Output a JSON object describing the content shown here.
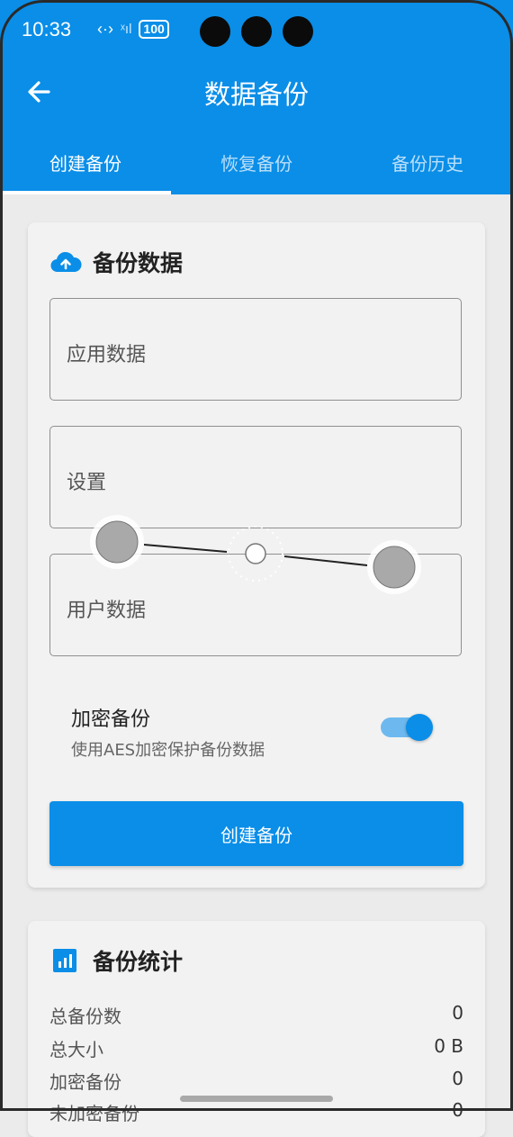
{
  "status_bar": {
    "time": "10:33",
    "network_icon": "‹·›",
    "signal_icon": "ˣıl",
    "battery": "100"
  },
  "header": {
    "title": "数据备份",
    "back_icon": "arrow-left-icon",
    "background_color": "#0a8ee8"
  },
  "tabs": [
    {
      "label": "创建备份",
      "active": true
    },
    {
      "label": "恢复备份",
      "active": false
    },
    {
      "label": "备份历史",
      "active": false
    }
  ],
  "backup_card": {
    "icon": "cloud-upload-icon",
    "title": "备份数据",
    "fields": [
      {
        "label": "应用数据"
      },
      {
        "label": "设置"
      },
      {
        "label": "用户数据"
      }
    ],
    "encrypt": {
      "title": "加密备份",
      "subtitle": "使用AES加密保护备份数据",
      "enabled": true
    },
    "create_button": "创建备份"
  },
  "stats_card": {
    "icon": "bar-chart-icon",
    "title": "备份统计",
    "rows": [
      {
        "label": "总备份数",
        "value": "0"
      },
      {
        "label": "总大小",
        "value": "0 B"
      },
      {
        "label": "加密备份",
        "value": "0"
      },
      {
        "label": "未加密备份",
        "value": "0"
      }
    ]
  }
}
